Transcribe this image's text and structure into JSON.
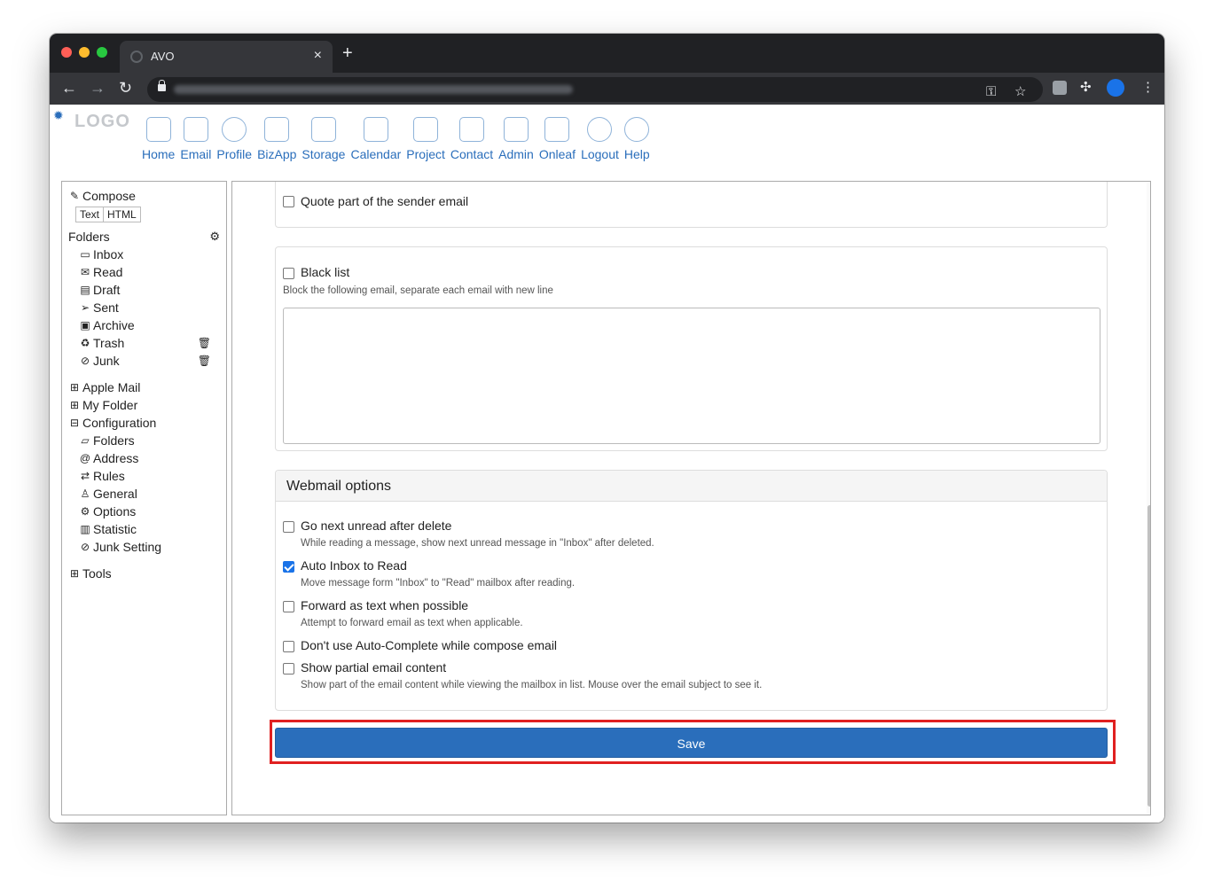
{
  "browser": {
    "tab_title": "AVO",
    "tab_close": "×",
    "new_tab": "+",
    "back": "←",
    "forward": "→",
    "reload": "↻"
  },
  "app": {
    "logo_text": "LOGO",
    "nav": [
      "Home",
      "Email",
      "Profile",
      "BizApp",
      "Storage",
      "Calendar",
      "Project",
      "Contact",
      "Admin",
      "Onleaf",
      "Logout",
      "Help"
    ]
  },
  "sidebar": {
    "compose": "Compose",
    "format_text": "Text",
    "format_html": "HTML",
    "folders_label": "Folders",
    "folders": [
      "Inbox",
      "Read",
      "Draft",
      "Sent",
      "Archive",
      "Trash",
      "Junk"
    ],
    "groups": [
      "Apple Mail",
      "My Folder",
      "Configuration"
    ],
    "config_items": [
      "Folders",
      "Address",
      "Rules",
      "General",
      "Options",
      "Statistic",
      "Junk Setting"
    ],
    "tools": "Tools"
  },
  "settings": {
    "quote_label": "Quote part of the sender email",
    "blacklist_label": "Black list",
    "blacklist_help": "Block the following email, separate each email with new line",
    "blacklist_value": "",
    "webmail_title": "Webmail options",
    "options": [
      {
        "label": "Go next unread after delete",
        "help": "While reading a message, show next unread message in \"Inbox\" after deleted.",
        "checked": false
      },
      {
        "label": "Auto Inbox to Read",
        "help": "Move message form \"Inbox\" to \"Read\" mailbox after reading.",
        "checked": true
      },
      {
        "label": "Forward as text when possible",
        "help": "Attempt to forward email as text when applicable.",
        "checked": false
      },
      {
        "label": "Don't use Auto-Complete while compose email",
        "help": "",
        "checked": false
      },
      {
        "label": "Show partial email content",
        "help": "Show part of the email content while viewing the mailbox in list. Mouse over the email subject to see it.",
        "checked": false
      }
    ],
    "save_label": "Save"
  },
  "colors": {
    "accent": "#2a6ebb",
    "highlight": "#e02020",
    "checked": "#1a73e8"
  }
}
